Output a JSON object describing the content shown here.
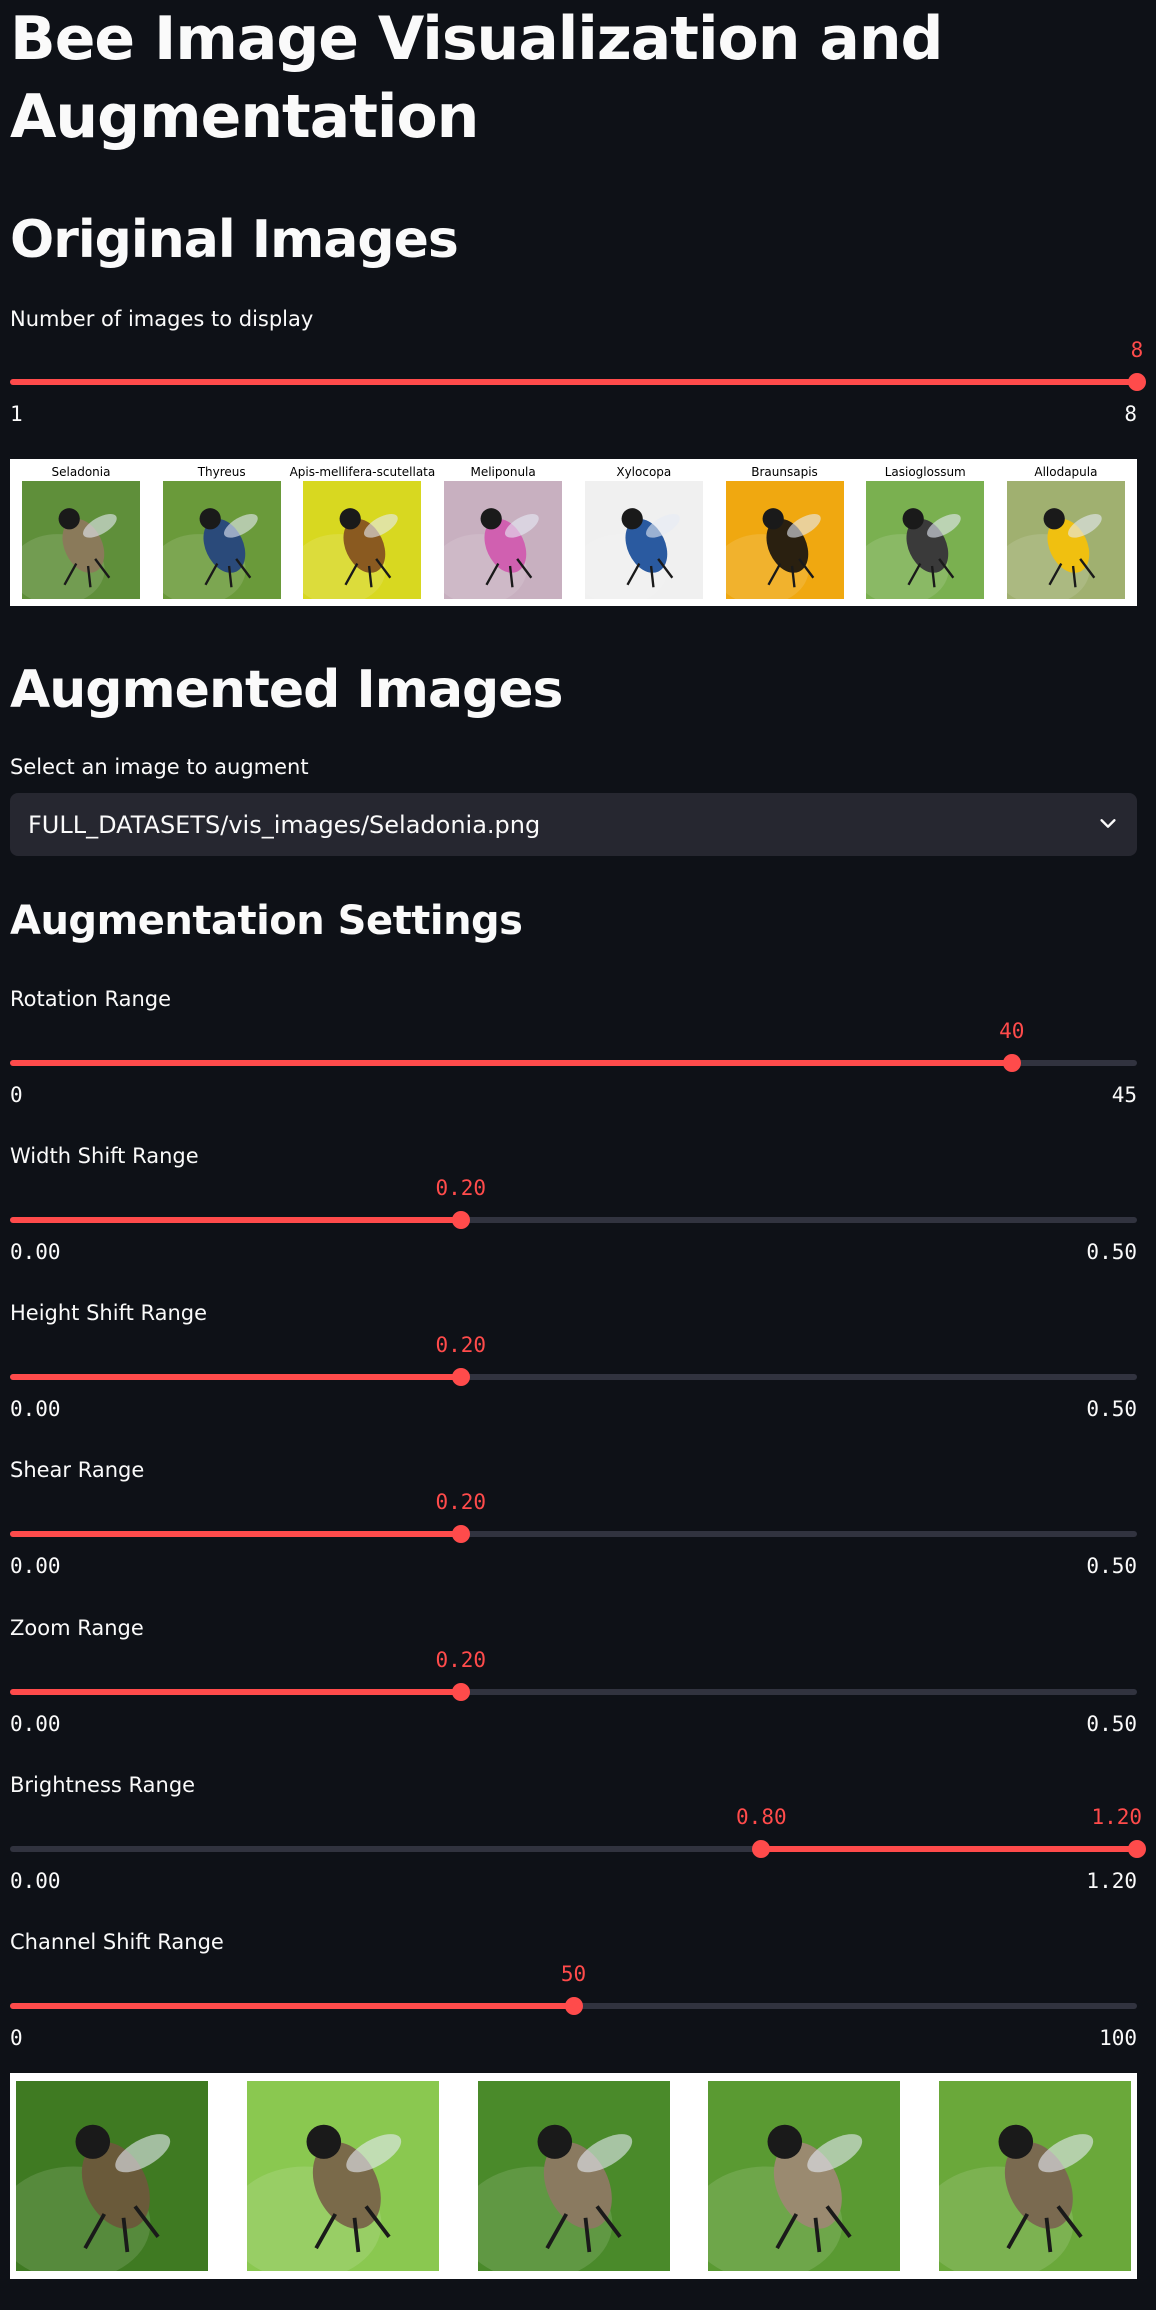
{
  "title": "Bee Image Visualization and Augmentation",
  "original": {
    "heading": "Original Images",
    "slider": {
      "label": "Number of images to display",
      "value": 8,
      "min": 1,
      "max": 8,
      "value_text": "8",
      "min_text": "1",
      "max_text": "8"
    },
    "images": [
      {
        "caption": "Seladonia",
        "bg": "#5f8f3a",
        "fg": "#8a7a5a"
      },
      {
        "caption": "Thyreus",
        "bg": "#6a9a3a",
        "fg": "#2a4a7a"
      },
      {
        "caption": "Apis-mellifera-scutellata",
        "bg": "#d8d820",
        "fg": "#8a5a20"
      },
      {
        "caption": "Meliponula",
        "bg": "#c8b0c0",
        "fg": "#d060b0"
      },
      {
        "caption": "Xylocopa",
        "bg": "#f0f0f0",
        "fg": "#2a5aa0"
      },
      {
        "caption": "Braunsapis",
        "bg": "#f0a810",
        "fg": "#2a2010"
      },
      {
        "caption": "Lasioglossum",
        "bg": "#7ab050",
        "fg": "#3a3a3a"
      },
      {
        "caption": "Allodapula",
        "bg": "#a0b070",
        "fg": "#f0c010"
      }
    ]
  },
  "augmented": {
    "heading": "Augmented Images",
    "select_label": "Select an image to augment",
    "select_value": "FULL_DATASETS/vis_images/Seladonia.png",
    "settings_heading": "Augmentation Settings",
    "sliders": [
      {
        "label": "Rotation Range",
        "value": 40,
        "min": 0,
        "max": 45,
        "value_text": "40",
        "min_text": "0",
        "max_text": "45"
      },
      {
        "label": "Width Shift Range",
        "value": 0.2,
        "min": 0,
        "max": 0.5,
        "value_text": "0.20",
        "min_text": "0.00",
        "max_text": "0.50"
      },
      {
        "label": "Height Shift Range",
        "value": 0.2,
        "min": 0,
        "max": 0.5,
        "value_text": "0.20",
        "min_text": "0.00",
        "max_text": "0.50"
      },
      {
        "label": "Shear Range",
        "value": 0.2,
        "min": 0,
        "max": 0.5,
        "value_text": "0.20",
        "min_text": "0.00",
        "max_text": "0.50"
      },
      {
        "label": "Zoom Range",
        "value": 0.2,
        "min": 0,
        "max": 0.5,
        "value_text": "0.20",
        "min_text": "0.00",
        "max_text": "0.50"
      },
      {
        "label": "Brightness Range",
        "range": [
          0.8,
          1.2
        ],
        "min": 0,
        "max": 1.2,
        "low_text": "0.80",
        "high_text": "1.20",
        "min_text": "0.00",
        "max_text": "1.20"
      },
      {
        "label": "Channel Shift Range",
        "value": 50,
        "min": 0,
        "max": 100,
        "value_text": "50",
        "min_text": "0",
        "max_text": "100"
      }
    ],
    "images": [
      {
        "bg": "#3f7a22",
        "fg": "#6a5a3a"
      },
      {
        "bg": "#8ac850",
        "fg": "#7a6a4a"
      },
      {
        "bg": "#4a8a2a",
        "fg": "#8a7a60"
      },
      {
        "bg": "#5a9a32",
        "fg": "#9a8a70"
      },
      {
        "bg": "#6aa83a",
        "fg": "#7a6a50"
      }
    ]
  },
  "colors": {
    "accent": "#ff4b4b",
    "background": "#0e1117",
    "track": "#31333f",
    "select_bg": "#262730"
  }
}
